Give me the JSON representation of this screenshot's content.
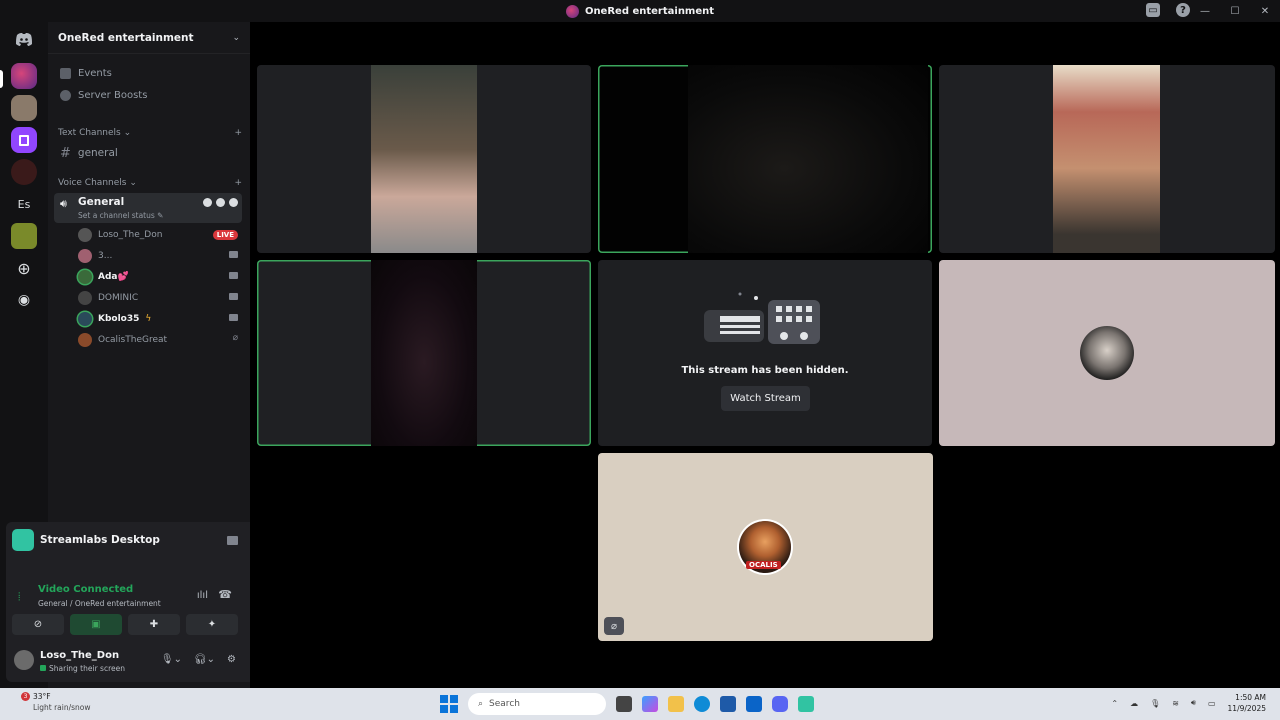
{
  "window": {
    "title": "OneRed entertainment"
  },
  "guild": {
    "name": "OneRed entertainment"
  },
  "nav": {
    "events": "Events",
    "boosts": "Server Boosts"
  },
  "text_channels": {
    "category": "Text Channels",
    "items": [
      "general"
    ]
  },
  "voice_channels": {
    "category": "Voice Channels",
    "active": {
      "name": "General",
      "status_placeholder": "Set a channel status"
    },
    "users": [
      {
        "name": "Loso_The_Don",
        "badge": "LIVE"
      },
      {
        "name": "3..."
      },
      {
        "name": "Ada💕"
      },
      {
        "name": "DOMINIC"
      },
      {
        "name": "Kbolo35"
      },
      {
        "name": "OcalisTheGreat"
      }
    ]
  },
  "servers": {
    "text_server": "Es"
  },
  "panel": {
    "app_name": "Streamlabs Desktop",
    "status": "Video Connected",
    "location": "General / OneRed entertainment",
    "user_name": "Loso_The_Don",
    "user_status": "Sharing their screen"
  },
  "stage": {
    "hidden_text": "This stream has been hidden.",
    "watch_label": "Watch Stream",
    "ocalis_label": "OCALIS"
  },
  "taskbar": {
    "weather_temp": "33°F",
    "weather_desc": "Light rain/snow",
    "weather_badge": "3",
    "search": "Search",
    "time": "1:50 AM",
    "date": "11/9/2025"
  },
  "colors": {
    "accent_green": "#3ba55c",
    "live_red": "#da373c",
    "bg": "#000000"
  }
}
